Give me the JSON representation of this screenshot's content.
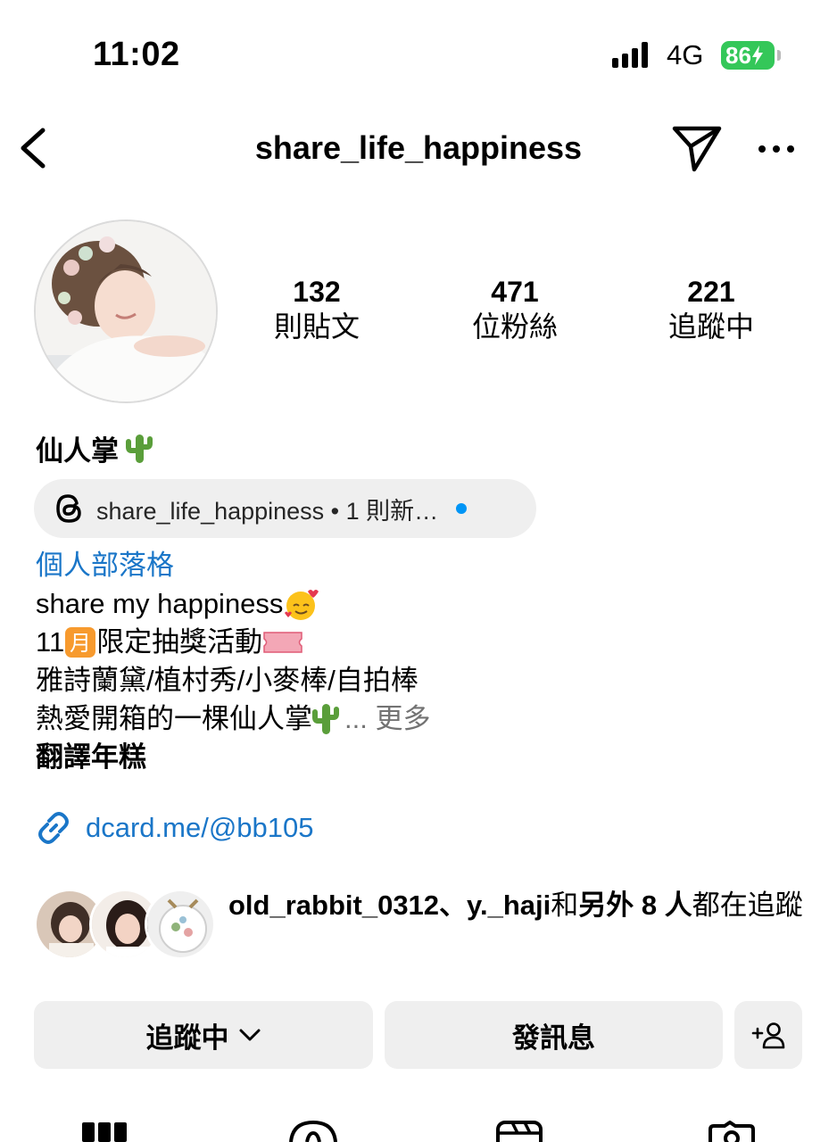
{
  "status_bar": {
    "time": "11:02",
    "network": "4G",
    "battery": "86"
  },
  "header": {
    "username": "share_life_happiness",
    "icons": [
      "back-chevron-icon",
      "send-icon",
      "more-icon"
    ]
  },
  "stats": [
    {
      "value": "132",
      "label": "則貼文"
    },
    {
      "value": "471",
      "label": "位粉絲"
    },
    {
      "value": "221",
      "label": "追蹤中"
    }
  ],
  "profile": {
    "display_name": "仙人掌",
    "threads_badge": "share_life_happiness • 1 則新…",
    "category": "個人部落格",
    "bio_lines": [
      "share my happiness",
      "11",
      "限定抽獎活動",
      "雅詩蘭黛/植村秀/小麥棒/自拍棒",
      "熱愛開箱的一棵仙人掌"
    ],
    "more_label": "... 更多",
    "translate_label": "翻譯年糕",
    "link": "dcard.me/@bb105"
  },
  "followed_by": {
    "names": "old_rabbit_0312、y._haji",
    "connector": "和",
    "others": "另外 8 人",
    "suffix": "都在追蹤"
  },
  "buttons": {
    "following": "追蹤中",
    "message": "發訊息"
  },
  "colors": {
    "link_blue": "#1a76c8",
    "button_bg": "#efefef",
    "battery_green": "#34c759",
    "threads_dot": "#0095f6"
  }
}
